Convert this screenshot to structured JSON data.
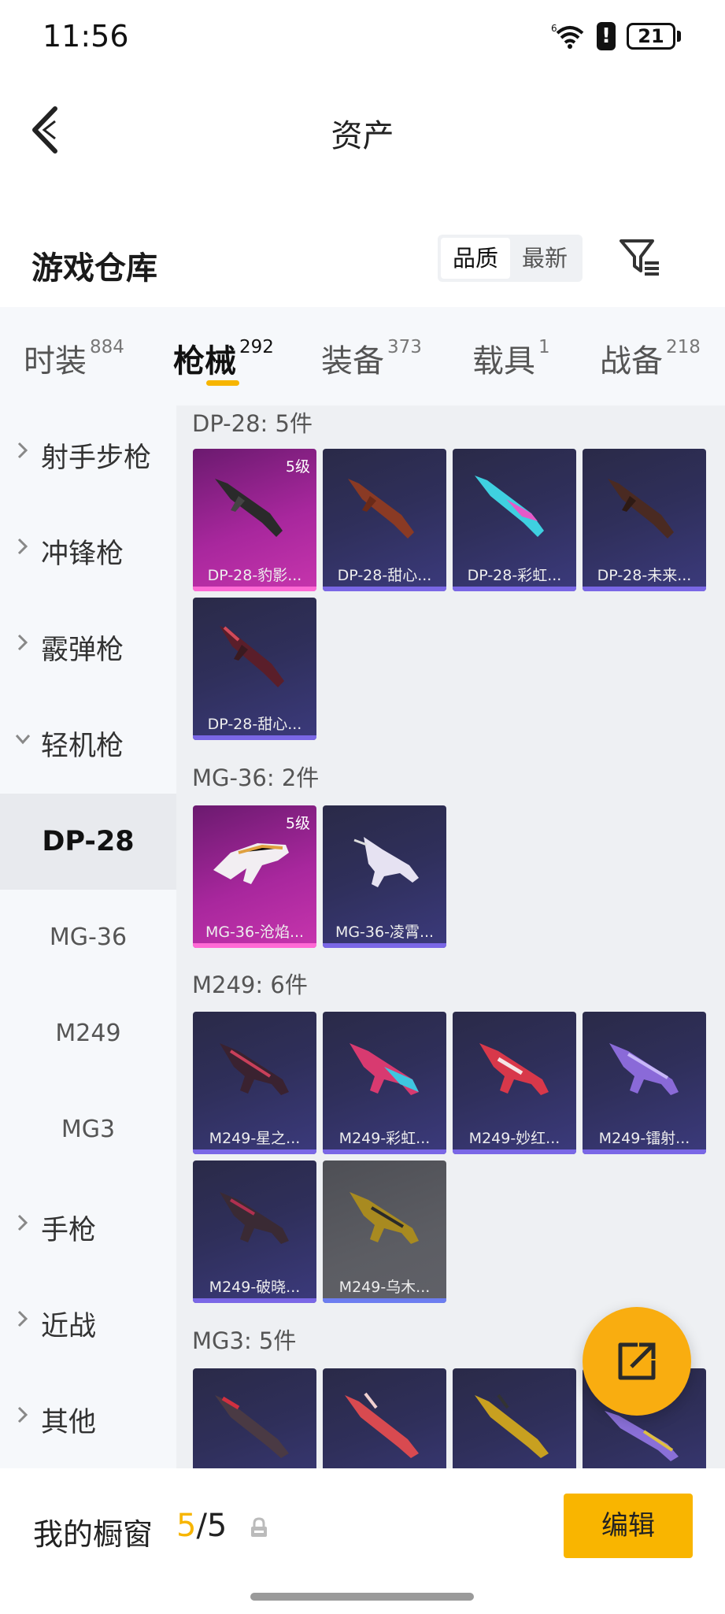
{
  "status": {
    "time": "11:56",
    "battery": "21"
  },
  "header": {
    "title": "资产"
  },
  "section": {
    "title": "游戏仓库",
    "sort_options": [
      "品质",
      "最新"
    ],
    "active_sort": "品质"
  },
  "tabs": [
    {
      "label": "时装",
      "count": "884"
    },
    {
      "label": "枪械",
      "count": "292",
      "active": true
    },
    {
      "label": "装备",
      "count": "373"
    },
    {
      "label": "载具",
      "count": "1"
    },
    {
      "label": "战备",
      "count": "218"
    }
  ],
  "sidebar": {
    "categories": [
      {
        "label": "射手步枪"
      },
      {
        "label": "冲锋枪"
      },
      {
        "label": "霰弹枪"
      },
      {
        "label": "轻机枪",
        "expanded": true
      }
    ],
    "sub_items": [
      "DP-28",
      "MG-36",
      "M249",
      "MG3"
    ],
    "active_sub": "DP-28",
    "more_categories": [
      "手枪",
      "近战",
      "其他"
    ]
  },
  "groups": [
    {
      "title": "DP-28: 5件",
      "items": [
        {
          "name": "DP-28-豹影...",
          "level": "5级",
          "rarity": "gold"
        },
        {
          "name": "DP-28-甜心...",
          "rarity": "purple"
        },
        {
          "name": "DP-28-彩虹...",
          "rarity": "purple"
        },
        {
          "name": "DP-28-未来...",
          "rarity": "purple"
        },
        {
          "name": "DP-28-甜心...",
          "rarity": "purple"
        }
      ]
    },
    {
      "title": "MG-36: 2件",
      "items": [
        {
          "name": "MG-36-沧焰...",
          "level": "5级",
          "rarity": "gold"
        },
        {
          "name": "MG-36-凌霄...",
          "rarity": "purple"
        }
      ]
    },
    {
      "title": "M249: 6件",
      "items": [
        {
          "name": "M249-星之...",
          "rarity": "purple"
        },
        {
          "name": "M249-彩虹...",
          "rarity": "purple"
        },
        {
          "name": "M249-妙红...",
          "rarity": "purple"
        },
        {
          "name": "M249-镭射...",
          "rarity": "purple"
        },
        {
          "name": "M249-破晓...",
          "rarity": "purple"
        },
        {
          "name": "M249-乌木...",
          "rarity": "gray"
        }
      ]
    },
    {
      "title": "MG3: 5件",
      "items": [
        {
          "name": "",
          "rarity": "purple"
        },
        {
          "name": "",
          "rarity": "purple"
        },
        {
          "name": "",
          "rarity": "purple"
        },
        {
          "name": "",
          "rarity": "purple"
        }
      ]
    }
  ],
  "showcase": {
    "label": "我的橱窗",
    "current": "5",
    "total": "/5",
    "edit_label": "编辑"
  },
  "colors": {
    "accent": "#f7b500",
    "gold_card": "#b22ca3",
    "purple_card": "#34346a"
  }
}
